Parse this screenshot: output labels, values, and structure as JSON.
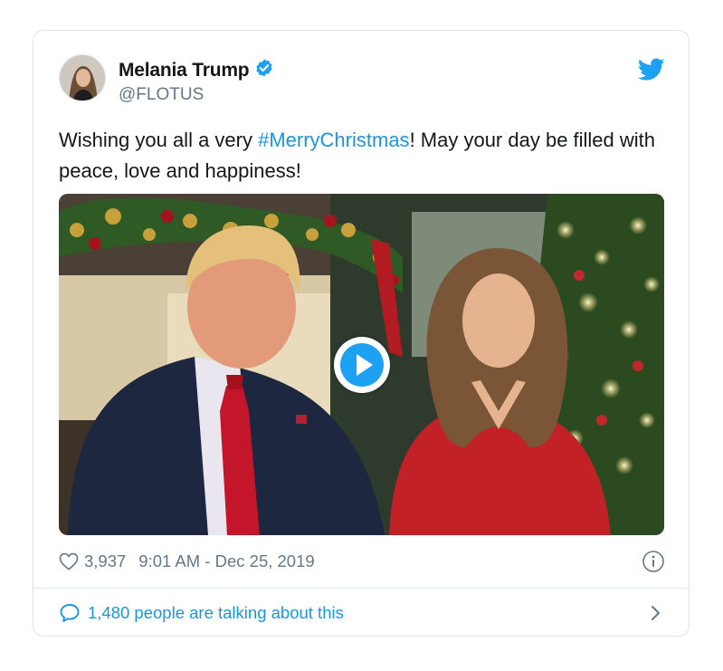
{
  "tweet": {
    "author_name": "Melania Trump",
    "author_handle": "@FLOTUS",
    "verified": true,
    "text_before": "Wishing you all a very ",
    "hashtag": "#MerryChristmas",
    "text_after": "! May your day be filled with peace, love and happiness!",
    "media_type": "video",
    "likes": "3,937",
    "timestamp": "9:01 AM - Dec 25, 2019",
    "conversation": "1,480 people are talking about this"
  },
  "icons": {
    "verified": "verified-badge-icon",
    "brand": "twitter-bird-icon",
    "play": "play-icon",
    "like": "heart-icon",
    "info": "info-icon",
    "reply": "speech-bubble-icon",
    "chevron": "chevron-right-icon"
  },
  "colors": {
    "brand_blue": "#1da1f2",
    "link_blue": "#1b95e0",
    "text_primary": "#14171a",
    "text_secondary": "#657786",
    "border": "#dfe3e8"
  }
}
